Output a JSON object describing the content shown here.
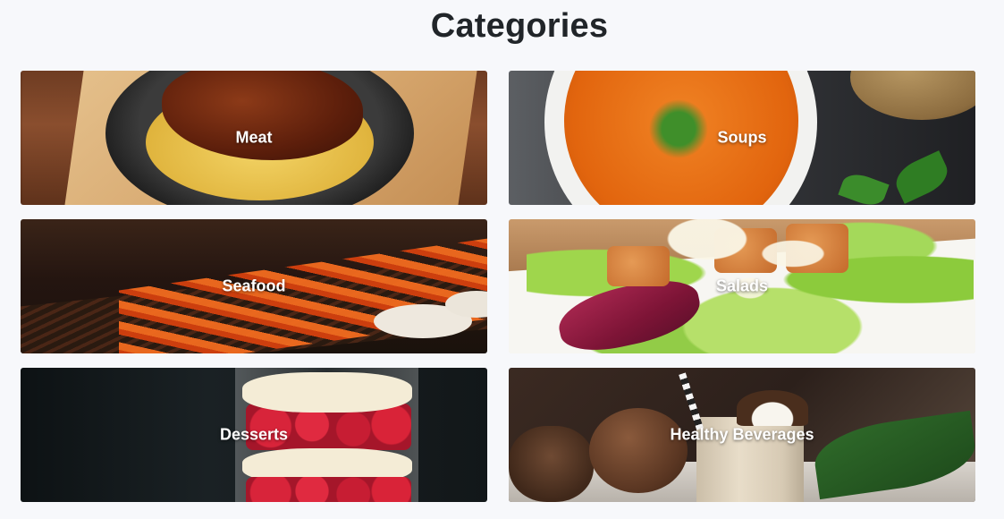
{
  "page": {
    "title": "Categories"
  },
  "categories": [
    {
      "label": "Meat"
    },
    {
      "label": "Soups"
    },
    {
      "label": "Seafood"
    },
    {
      "label": "Salads"
    },
    {
      "label": "Desserts"
    },
    {
      "label": "Healthy Beverages"
    }
  ]
}
